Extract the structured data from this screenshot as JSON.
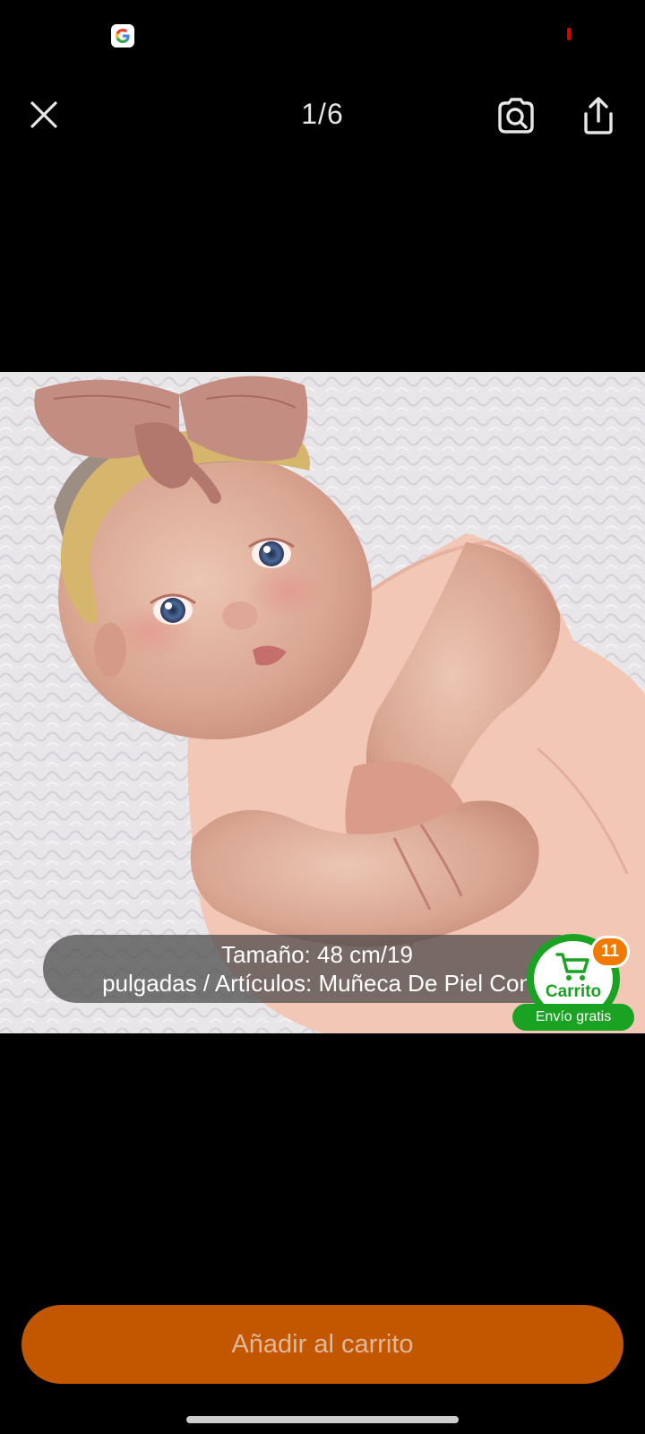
{
  "status_bar": {
    "google_icon": "google-g-icon",
    "recording_indicator_color": "#e00000"
  },
  "viewer": {
    "counter": "1/6",
    "close_icon": "close-icon",
    "lens_icon": "image-search-icon",
    "share_icon": "share-icon"
  },
  "photo": {
    "subject": "reborn-baby-doll-photo"
  },
  "caption": {
    "line1": "Tamaño: 48 cm/19",
    "line2": "pulgadas / Artículos: Muñeca De Piel Con"
  },
  "cart": {
    "count": "11",
    "label": "Carrito",
    "free_shipping": "Envío gratis",
    "accent_color": "#1aa322",
    "badge_color": "#f07a00"
  },
  "actions": {
    "add_to_cart": "Añadir al carrito",
    "button_color": "#c25700"
  }
}
